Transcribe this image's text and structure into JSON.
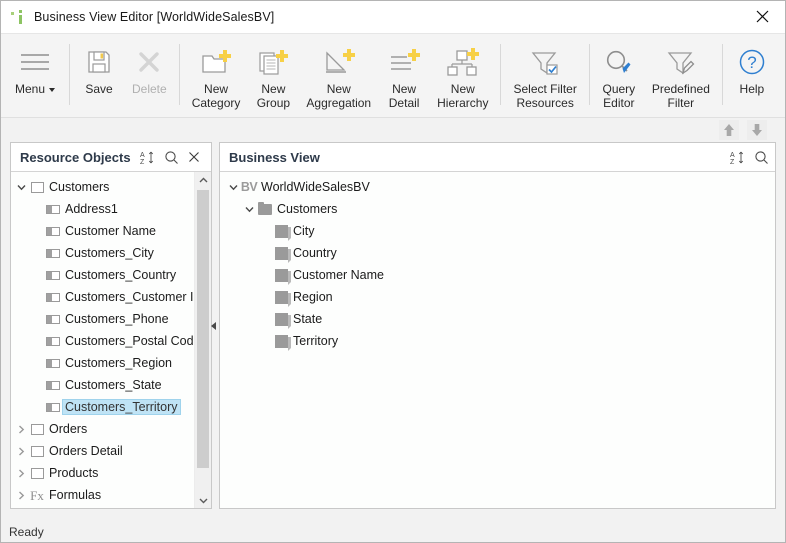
{
  "window": {
    "title": "Business View Editor [WorldWideSalesBV]",
    "app_icon": "bar-chart-icon",
    "close_label": "×"
  },
  "toolbar": {
    "items": [
      {
        "id": "menu",
        "label": "Menu",
        "icon": "hamburger-icon",
        "enabled": true,
        "has_caret": true
      },
      {
        "id": "save",
        "label": "Save",
        "icon": "floppy-disk-icon",
        "enabled": true,
        "has_caret": false
      },
      {
        "id": "delete",
        "label": "Delete",
        "icon": "x-delete-icon",
        "enabled": false,
        "has_caret": false
      },
      {
        "id": "new-category",
        "label": "New\nCategory",
        "icon": "folder-plus-icon",
        "enabled": true,
        "has_caret": false
      },
      {
        "id": "new-group",
        "label": "New\nGroup",
        "icon": "documents-plus-icon",
        "enabled": true,
        "has_caret": false
      },
      {
        "id": "new-aggregation",
        "label": "New\nAggregation",
        "icon": "triangle-plus-icon",
        "enabled": true,
        "has_caret": false
      },
      {
        "id": "new-detail",
        "label": "New\nDetail",
        "icon": "lines-plus-icon",
        "enabled": true,
        "has_caret": false
      },
      {
        "id": "new-hierarchy",
        "label": "New\nHierarchy",
        "icon": "hierarchy-plus-icon",
        "enabled": true,
        "has_caret": false
      },
      {
        "id": "select-filter-resources",
        "label": "Select Filter\nResources",
        "icon": "funnel-check-icon",
        "enabled": true,
        "has_caret": false
      },
      {
        "id": "query-editor",
        "label": "Query\nEditor",
        "icon": "magnifier-pencil-icon",
        "enabled": true,
        "has_caret": false
      },
      {
        "id": "predefined-filter",
        "label": "Predefined\nFilter",
        "icon": "funnel-pencil-icon",
        "enabled": true,
        "has_caret": false
      },
      {
        "id": "help",
        "label": "Help",
        "icon": "question-circle-icon",
        "enabled": true,
        "has_caret": false
      }
    ]
  },
  "midbar": {
    "move_up": "move-up-arrow",
    "move_down": "move-down-arrow"
  },
  "left_panel": {
    "title": "Resource Objects",
    "header_icons": [
      "sort-az-icon",
      "search-icon",
      "close-icon"
    ],
    "nodes": [
      {
        "label": "Customers",
        "indent": 0,
        "icon": "folder-outline-icon",
        "expander": "expanded",
        "selected": false
      },
      {
        "label": "Address1",
        "indent": 1,
        "icon": "field-icon",
        "expander": "none",
        "selected": false
      },
      {
        "label": "Customer Name",
        "indent": 1,
        "icon": "field-icon",
        "expander": "none",
        "selected": false
      },
      {
        "label": "Customers_City",
        "indent": 1,
        "icon": "field-icon",
        "expander": "none",
        "selected": false
      },
      {
        "label": "Customers_Country",
        "indent": 1,
        "icon": "field-icon",
        "expander": "none",
        "selected": false
      },
      {
        "label": "Customers_Customer ID",
        "indent": 1,
        "icon": "field-icon",
        "expander": "none",
        "selected": false
      },
      {
        "label": "Customers_Phone",
        "indent": 1,
        "icon": "field-icon",
        "expander": "none",
        "selected": false
      },
      {
        "label": "Customers_Postal Code",
        "indent": 1,
        "icon": "field-icon",
        "expander": "none",
        "selected": false
      },
      {
        "label": "Customers_Region",
        "indent": 1,
        "icon": "field-icon",
        "expander": "none",
        "selected": false
      },
      {
        "label": "Customers_State",
        "indent": 1,
        "icon": "field-icon",
        "expander": "none",
        "selected": false
      },
      {
        "label": "Customers_Territory",
        "indent": 1,
        "icon": "field-icon",
        "expander": "none",
        "selected": true
      },
      {
        "label": "Orders",
        "indent": 0,
        "icon": "folder-outline-icon",
        "expander": "collapsed",
        "selected": false
      },
      {
        "label": "Orders Detail",
        "indent": 0,
        "icon": "folder-outline-icon",
        "expander": "collapsed",
        "selected": false
      },
      {
        "label": "Products",
        "indent": 0,
        "icon": "folder-outline-icon",
        "expander": "collapsed",
        "selected": false
      },
      {
        "label": "Formulas",
        "indent": 0,
        "icon": "fx-icon",
        "expander": "collapsed",
        "selected": false
      }
    ]
  },
  "right_panel": {
    "title": "Business View",
    "header_icons": [
      "sort-az-icon",
      "search-icon"
    ],
    "nodes": [
      {
        "label": "WorldWideSalesBV",
        "indent": 0,
        "icon": "bv-icon",
        "expander": "expanded",
        "selected": false
      },
      {
        "label": "Customers",
        "indent": 1,
        "icon": "folder-solid-icon",
        "expander": "expanded",
        "selected": false
      },
      {
        "label": "City",
        "indent": 2,
        "icon": "bv-field-icon",
        "expander": "none",
        "selected": false
      },
      {
        "label": "Country",
        "indent": 2,
        "icon": "bv-field-icon",
        "expander": "none",
        "selected": false
      },
      {
        "label": "Customer Name",
        "indent": 2,
        "icon": "bv-field-icon",
        "expander": "none",
        "selected": false
      },
      {
        "label": "Region",
        "indent": 2,
        "icon": "bv-field-icon",
        "expander": "none",
        "selected": false
      },
      {
        "label": "State",
        "indent": 2,
        "icon": "bv-field-icon",
        "expander": "none",
        "selected": false
      },
      {
        "label": "Territory",
        "indent": 2,
        "icon": "bv-field-icon",
        "expander": "none",
        "selected": false
      }
    ]
  },
  "statusbar": {
    "text": "Ready"
  },
  "colors": {
    "accent_yellow": "#f7d046",
    "accent_blue": "#2f7fd0",
    "selection_blue": "#bfe3f5",
    "icon_gray": "#9a9a9a",
    "app_green": "#6cb33f"
  }
}
